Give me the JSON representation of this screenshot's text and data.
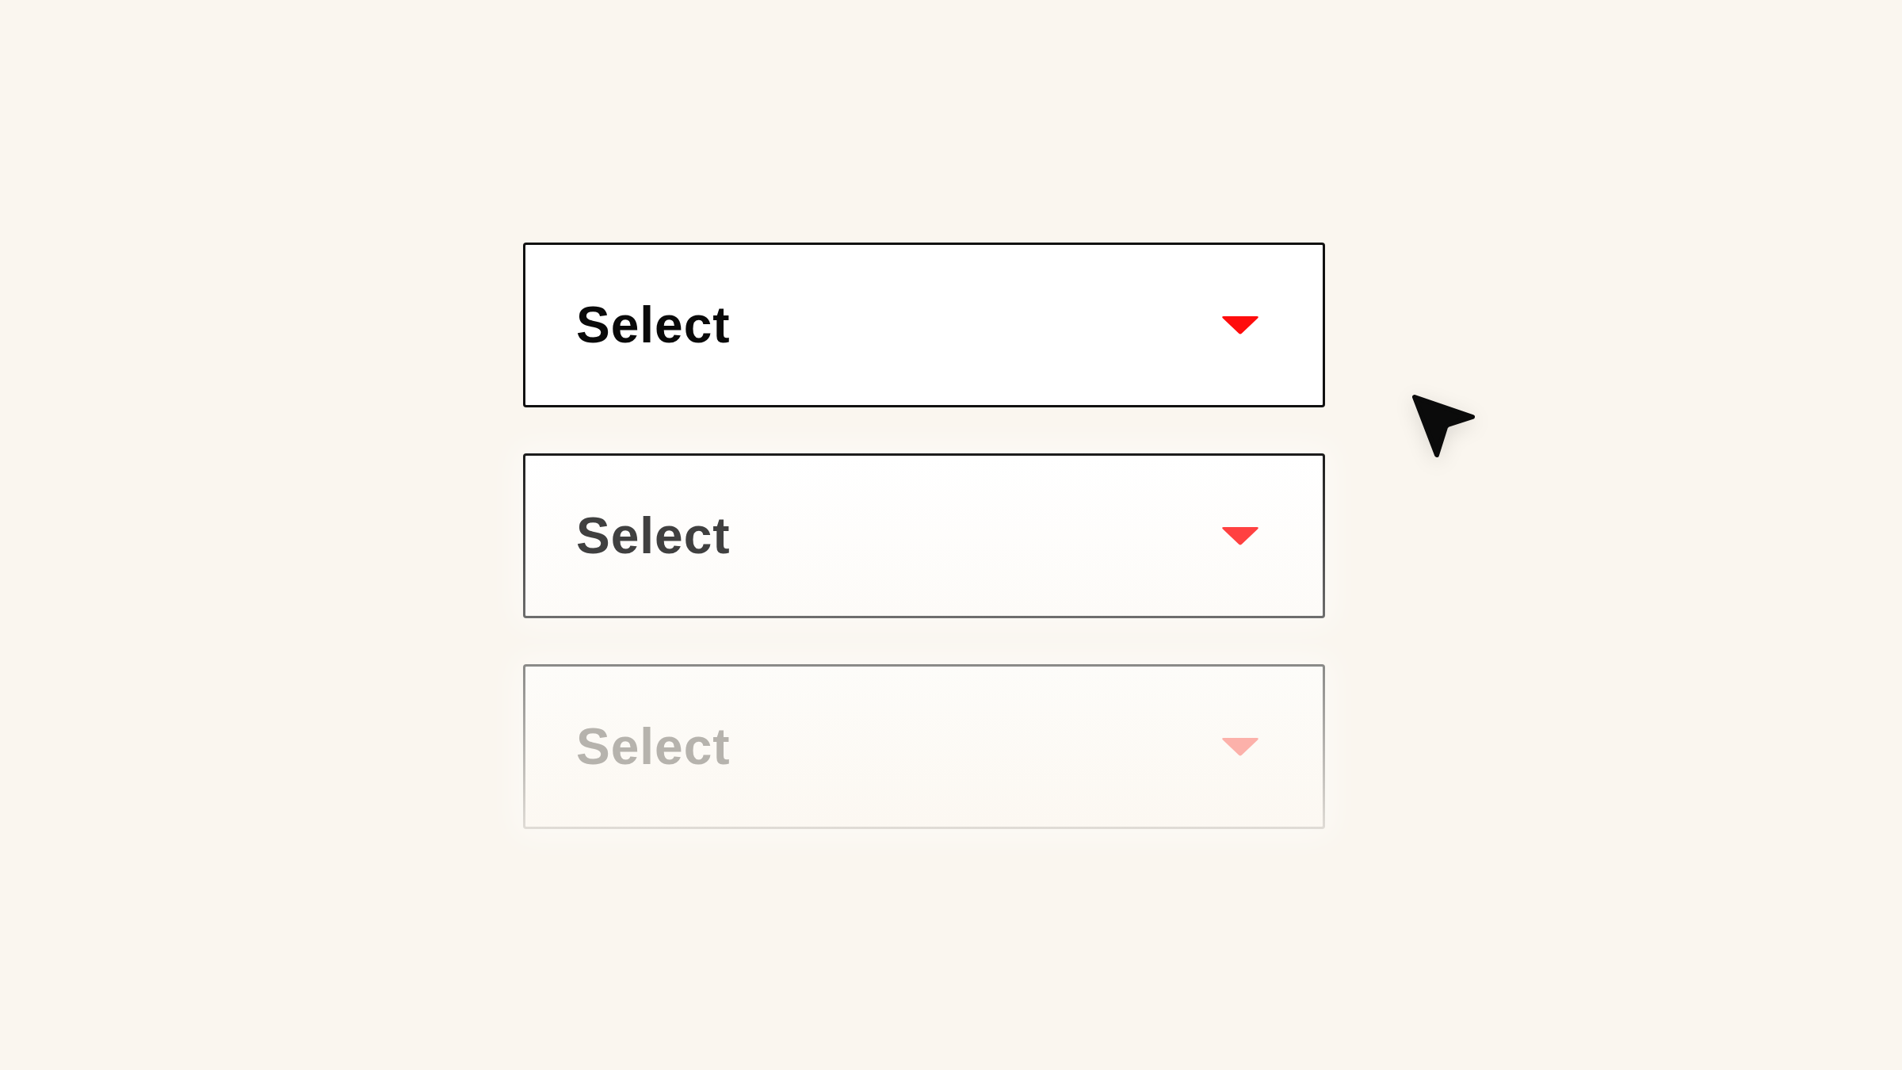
{
  "selects": [
    {
      "label": "Select",
      "kind": "active"
    },
    {
      "label": "Select",
      "kind": "muted"
    },
    {
      "label": "Select",
      "kind": "faded"
    }
  ]
}
